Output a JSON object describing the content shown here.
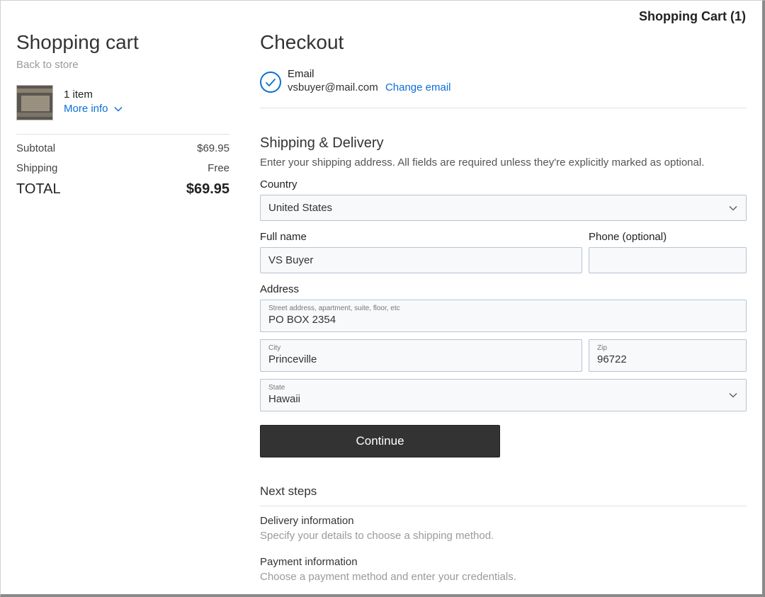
{
  "header": {
    "cart_label": "Shopping Cart (1)"
  },
  "cart": {
    "title": "Shopping cart",
    "back_link": "Back to store",
    "item_count": "1 item",
    "more_info": "More info",
    "subtotal_label": "Subtotal",
    "subtotal_value": "$69.95",
    "shipping_label": "Shipping",
    "shipping_value": "Free",
    "total_label": "TOTAL",
    "total_value": "$69.95"
  },
  "checkout": {
    "title": "Checkout",
    "email_label": "Email",
    "email_value": "vsbuyer@mail.com",
    "change_email": "Change email",
    "shipping_title": "Shipping & Delivery",
    "shipping_desc": "Enter your shipping address. All fields are required unless they're explicitly marked as optional.",
    "country_label": "Country",
    "country_value": "United States",
    "fullname_label": "Full name",
    "fullname_value": "VS Buyer",
    "phone_label": "Phone (optional)",
    "phone_value": "",
    "address_label": "Address",
    "street_label": "Street address, apartment, suite, floor, etc",
    "street_value": "PO BOX 2354",
    "city_label": "City",
    "city_value": "Princeville",
    "zip_label": "Zip",
    "zip_value": "96722",
    "state_label": "State",
    "state_value": "Hawaii",
    "continue_label": "Continue"
  },
  "next_steps": {
    "title": "Next steps",
    "steps": [
      {
        "title": "Delivery information",
        "desc": "Specify your details to choose a shipping method."
      },
      {
        "title": "Payment information",
        "desc": "Choose a payment method and enter your credentials."
      }
    ]
  },
  "colors": {
    "accent": "#0a6fd8",
    "button_bg": "#333333",
    "input_border": "#b7c3d2"
  },
  "icons": [
    "check-icon",
    "chevron-down-icon",
    "product-thumbnail"
  ]
}
